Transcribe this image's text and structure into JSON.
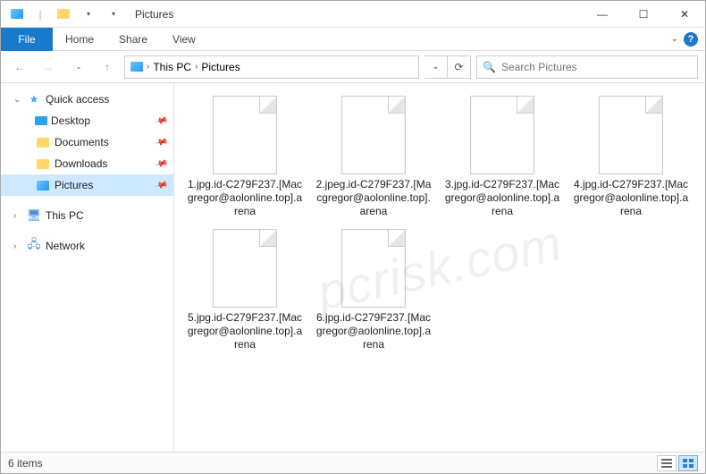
{
  "titlebar": {
    "separator": "|",
    "title": "Pictures"
  },
  "window_controls": {
    "min": "—",
    "max": "☐",
    "close": "✕"
  },
  "ribbon": {
    "file": "File",
    "tabs": [
      "Home",
      "Share",
      "View"
    ],
    "expand": "⌄",
    "help": "?"
  },
  "nav": {
    "back": "←",
    "forward": "→",
    "up": "↑",
    "recent": "⌄",
    "refresh": "⟳",
    "dropdown": "⌄"
  },
  "breadcrumb": {
    "sep": "›",
    "parts": [
      "This PC",
      "Pictures"
    ]
  },
  "search": {
    "icon": "🔍",
    "placeholder": "Search Pictures"
  },
  "sidebar": {
    "quick_access": "Quick access",
    "items": [
      {
        "label": "Desktop",
        "icon": "desktop"
      },
      {
        "label": "Documents",
        "icon": "folder"
      },
      {
        "label": "Downloads",
        "icon": "folder"
      },
      {
        "label": "Pictures",
        "icon": "pictures",
        "selected": true
      }
    ],
    "this_pc": "This PC",
    "network": "Network"
  },
  "files": [
    "1.jpg.id-C279F237.[Macgregor@aolonline.top].arena",
    "2.jpeg.id-C279F237.[Macgregor@aolonline.top].arena",
    "3.jpg.id-C279F237.[Macgregor@aolonline.top].arena",
    "4.jpg.id-C279F237.[Macgregor@aolonline.top].arena",
    "5.jpg.id-C279F237.[Macgregor@aolonline.top].arena",
    "6.jpg.id-C279F237.[Macgregor@aolonline.top].arena"
  ],
  "status": {
    "count": "6 items"
  },
  "watermark": "pcrisk.com"
}
